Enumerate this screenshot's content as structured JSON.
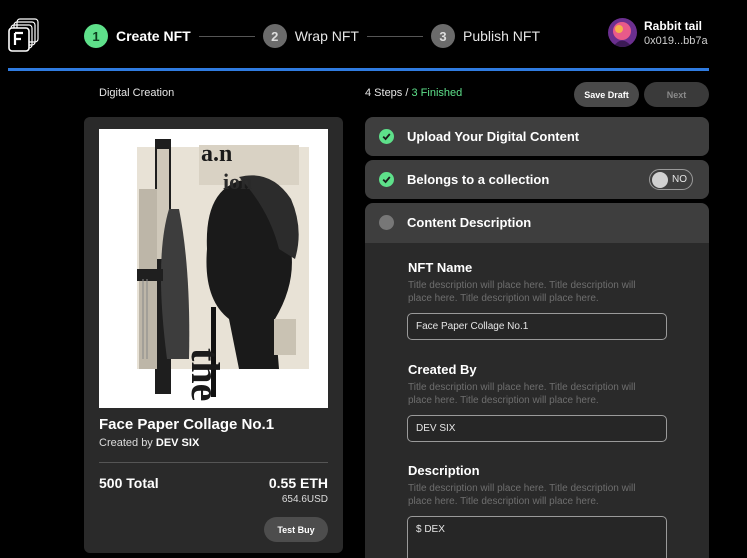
{
  "stepper": {
    "steps": [
      {
        "num": "1",
        "label": "Create NFT"
      },
      {
        "num": "2",
        "label": "Wrap NFT"
      },
      {
        "num": "3",
        "label": "Publish NFT"
      }
    ]
  },
  "user": {
    "name": "Rabbit tail",
    "address": "0x019...bb7a"
  },
  "main": {
    "section_label": "Digital Creation",
    "steps_total": "4 Steps",
    "steps_sep": " / ",
    "steps_finished": "3 Finished",
    "save_draft": "Save Draft",
    "next": "Next"
  },
  "nft_card": {
    "title": "Face Paper Collage No.1",
    "created_by_prefix": "Created by ",
    "creator": "DEV SIX",
    "total": "500 Total",
    "price_eth": "0.55 ETH",
    "price_usd": "654.6USD",
    "test_buy": "Test Buy",
    "artwork_text": "the",
    "artwork_headline": "a.n",
    "artwork_headline2": "ion"
  },
  "accordion": {
    "upload": "Upload Your Digital Content",
    "collection": "Belongs to a collection",
    "toggle": "NO",
    "content": "Content Description"
  },
  "form": {
    "nft_name_label": "NFT Name",
    "nft_name_desc": "Title description will place here. Title description will place here. Title description will place here.",
    "nft_name_value": "Face Paper Collage No.1",
    "created_by_label": "Created By",
    "created_by_desc": "Title description will place here. Title description will place here. Title description will place here.",
    "created_by_value": "DEV SIX",
    "description_label": "Description",
    "description_desc": "Title description will place here. Title description will place here. Title description will place here.",
    "description_value": "$ DEX"
  },
  "colors": {
    "accent_green": "#5ee08a",
    "rule_blue": "#2f7be0",
    "panel": "#3e3e3e",
    "card": "#2a2a2a"
  },
  "icons": [
    "logo-icon",
    "check-icon",
    "dot-icon",
    "avatar"
  ]
}
